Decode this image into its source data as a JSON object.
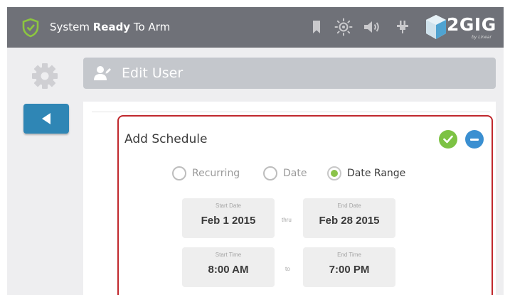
{
  "topbar": {
    "status_prefix": "System",
    "status_ready": "Ready",
    "status_suffix": "To Arm",
    "logo_text": "2GIG",
    "logo_sub": "by Linear"
  },
  "header": {
    "title": "Edit User"
  },
  "schedule": {
    "title": "Add Schedule",
    "radios": [
      {
        "label": "Recurring",
        "selected": false
      },
      {
        "label": "Date",
        "selected": false
      },
      {
        "label": "Date Range",
        "selected": true
      }
    ],
    "start_date": {
      "label": "Start Date",
      "value": "Feb 1 2015"
    },
    "thru_label": "thru",
    "end_date": {
      "label": "End Date",
      "value": "Feb 28 2015"
    },
    "start_time": {
      "label": "Start Time",
      "value": "8:00 AM"
    },
    "to_label": "to",
    "end_time": {
      "label": "End Time",
      "value": "7:00 PM"
    }
  },
  "colors": {
    "topbar": "#6f7178",
    "accent_green": "#7cc243",
    "accent_blue": "#3a8fd1",
    "back_button": "#2f86b5",
    "panel_border": "#c0282d"
  }
}
